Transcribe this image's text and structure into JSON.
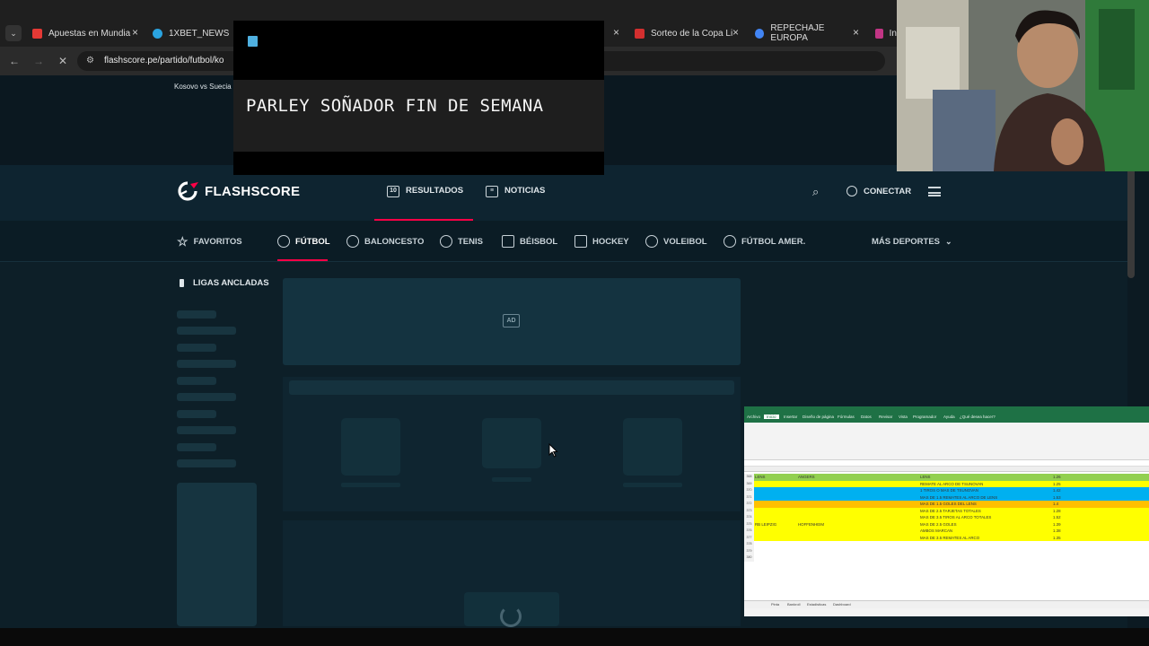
{
  "browser": {
    "tabs": [
      {
        "title": "Apuestas en Mundia",
        "color": "#e53935"
      },
      {
        "title": "1XBET_NEWS",
        "color": "#2aa3df"
      },
      {
        "title": "Sorteo de la Copa Li",
        "color": "#d32f2f"
      },
      {
        "title": "REPECHAJE EUROPA",
        "color": "#4285f4"
      },
      {
        "title": "In",
        "color": "#c13584"
      }
    ],
    "url": "flashscore.pe/partido/futbol/ko",
    "close_glyph": "×"
  },
  "overlay": {
    "banner_text": "PARLEY SOÑADOR FIN DE SEMANA"
  },
  "page": {
    "breadcrumb": "Kosovo vs Suecia",
    "logo_text": "FLASHSCORE",
    "header_nav": [
      {
        "label": "RESULTADOS",
        "icon": "scoreboard-icon",
        "active": true
      },
      {
        "label": "NOTICIAS",
        "icon": "news-icon",
        "active": false
      }
    ],
    "connect_label": "CONECTAR",
    "sports": [
      {
        "label": "FAVORITOS",
        "icon": "star-icon"
      },
      {
        "label": "FÚTBOL",
        "icon": "soccer-ball-icon",
        "active": true
      },
      {
        "label": "BALONCESTO",
        "icon": "basketball-icon"
      },
      {
        "label": "TENIS",
        "icon": "tennis-icon"
      },
      {
        "label": "BÉISBOL",
        "icon": "baseball-icon"
      },
      {
        "label": "HOCKEY",
        "icon": "hockey-icon"
      },
      {
        "label": "VOLEIBOL",
        "icon": "volleyball-icon"
      },
      {
        "label": "FÚTBOL AMER.",
        "icon": "american-football-icon"
      }
    ],
    "more_sports_label": "MÁS DEPORTES",
    "pinned_leagues_title": "LIGAS ANCLADAS",
    "ad_label": "AD",
    "accent": "#ff0046"
  },
  "spreadsheet": {
    "ribbon_tabs": [
      "Archivo",
      "Inicio",
      "Insertar",
      "Diseño de página",
      "Fórmulas",
      "Datos",
      "Revisar",
      "Vista",
      "Programador",
      "Ayuda",
      "¿Qué desea hacer?"
    ],
    "rows": [
      {
        "num": "368",
        "a": "LENS",
        "b": "ANGERS",
        "c": "LENS",
        "d": "1.26",
        "bg": "#92d050"
      },
      {
        "num": "369",
        "a": "",
        "b": "",
        "c": "REMATE AL ARCO DE TSUNOVAN",
        "d": "1.25",
        "bg": "#ffff00"
      },
      {
        "num": "370",
        "a": "",
        "b": "",
        "c": "1 TIROS O MAS DE TSUNOVAN",
        "d": "1.42",
        "bg": "#00b0f0"
      },
      {
        "num": "371",
        "a": "",
        "b": "",
        "c": "MAS DE 1.5 REMATES AL ARCO DE LENS",
        "d": "1.53",
        "bg": "#00b0f0"
      },
      {
        "num": "372",
        "a": "",
        "b": "",
        "c": "MAS DE 1.5 GOLES DEL LENS",
        "d": "1.4",
        "bg": "#ffc000"
      },
      {
        "num": "373",
        "a": "",
        "b": "",
        "c": "MAS DE 2.5 TARJETAS TOTALES",
        "d": "1.28",
        "bg": "#ffff00"
      },
      {
        "num": "374",
        "a": "",
        "b": "",
        "c": "MAS DE 3.5 TIROS AL ARCO TOTALES",
        "d": "1.52",
        "bg": "#ffff00"
      },
      {
        "num": "375",
        "a": "RB LEIPZIG",
        "b": "HOFFENHEIM",
        "c": "MAS DE 2.5 GOLES",
        "d": "1.39",
        "bg": "#ffff00"
      },
      {
        "num": "376",
        "a": "",
        "b": "",
        "c": "AMBOS MARCAN",
        "d": "1.38",
        "bg": "#ffff00"
      },
      {
        "num": "377",
        "a": "",
        "b": "",
        "c": "MAS DE 3.5 REMATES AL ARCO",
        "d": "1.35",
        "bg": "#ffff00"
      },
      {
        "num": "378",
        "a": "",
        "b": "",
        "c": "",
        "d": "",
        "bg": "#ffffff"
      },
      {
        "num": "379",
        "a": "",
        "b": "",
        "c": "",
        "d": "",
        "bg": "#ffffff"
      },
      {
        "num": "380",
        "a": "",
        "b": "",
        "c": "",
        "d": "",
        "bg": "#ffffff"
      }
    ],
    "sheet_tabs": [
      "Pinta",
      "Bankroll",
      "Estadisticas",
      "Dashboard"
    ]
  }
}
